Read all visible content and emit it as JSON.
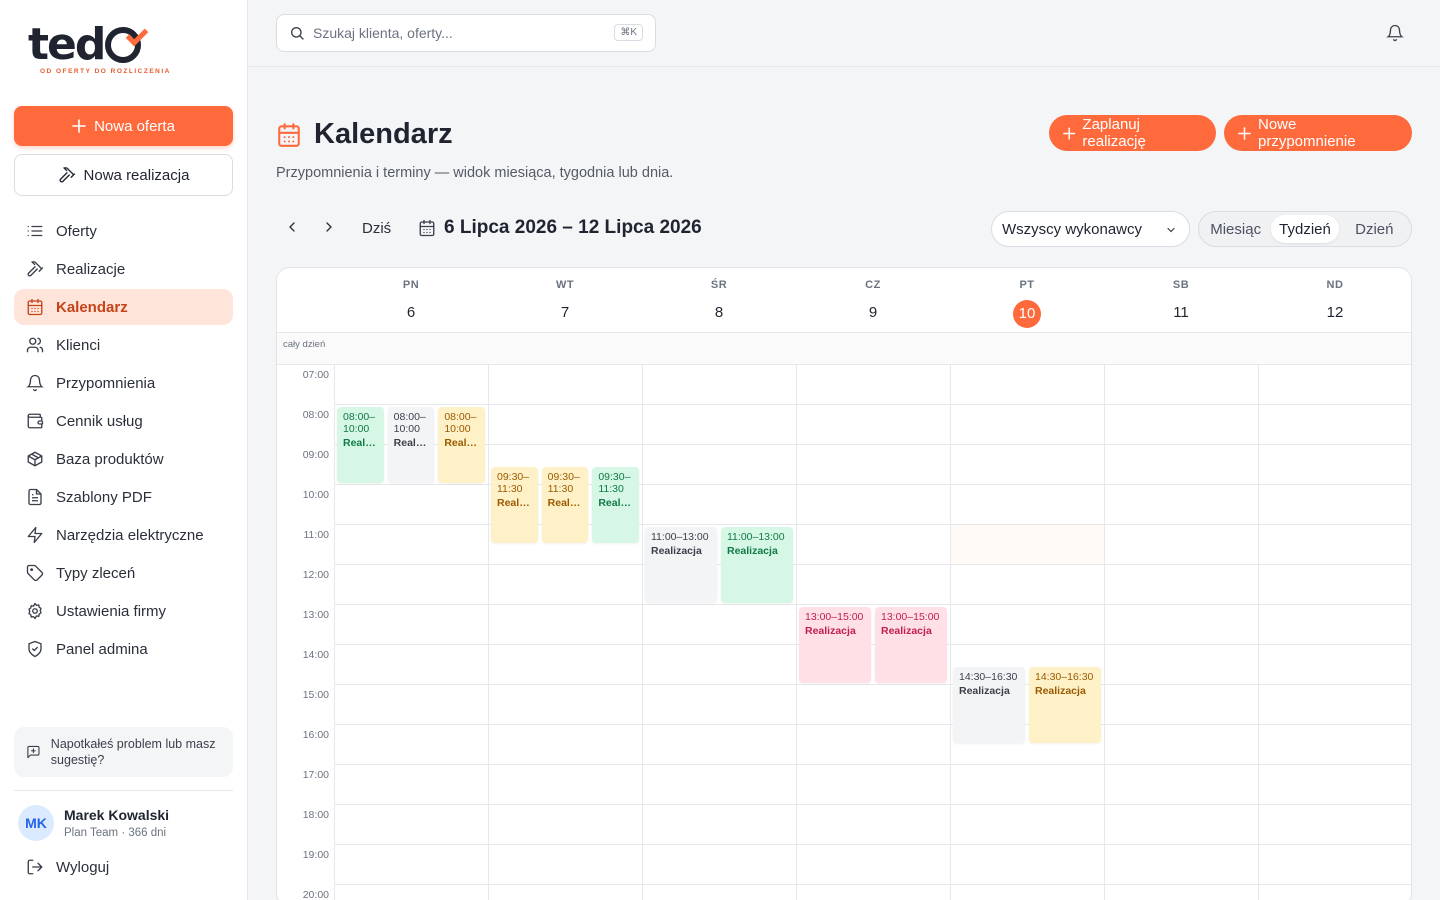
{
  "brand": {
    "name": "teodo",
    "tagline": "OD OFERTY DO ROZLICZENIA"
  },
  "sidebar": {
    "new_offer": "Nowa oferta",
    "new_realization": "Nowa realizacja",
    "items": [
      {
        "label": "Oferty",
        "icon": "list-icon"
      },
      {
        "label": "Realizacje",
        "icon": "hammer-icon"
      },
      {
        "label": "Kalendarz",
        "icon": "calendar-icon",
        "active": true
      },
      {
        "label": "Klienci",
        "icon": "users-icon"
      },
      {
        "label": "Przypomnienia",
        "icon": "bell-icon"
      },
      {
        "label": "Cennik usług",
        "icon": "wallet-icon"
      },
      {
        "label": "Baza produktów",
        "icon": "package-icon"
      },
      {
        "label": "Szablony PDF",
        "icon": "file-icon"
      },
      {
        "label": "Narzędzia elektryczne",
        "icon": "zap-icon"
      },
      {
        "label": "Typy zleceń",
        "icon": "tag-icon"
      },
      {
        "label": "Ustawienia firmy",
        "icon": "gear-icon"
      },
      {
        "label": "Panel admina",
        "icon": "shield-icon"
      }
    ],
    "feedback": "Napotkałeś problem lub masz sugestię?",
    "user": {
      "initials": "MK",
      "name": "Marek Kowalski",
      "plan": "Plan Team · 366 dni"
    },
    "logout": "Wyloguj"
  },
  "topbar": {
    "search_placeholder": "Szukaj klienta, oferty...",
    "shortcut": "⌘K"
  },
  "page": {
    "title": "Kalendarz",
    "subtitle": "Przypomnienia i terminy — widok miesiąca, tygodnia lub dnia.",
    "btn_schedule": "Zaplanuj realizację",
    "btn_reminder": "Nowe przypomnienie"
  },
  "toolbar": {
    "today": "Dziś",
    "range": "6 Lipca 2026 – 12 Lipca 2026",
    "assignee": "Wszyscy wykonawcy",
    "views": [
      "Miesiąc",
      "Tydzień",
      "Dzień"
    ],
    "active_view": "Tydzień"
  },
  "calendar": {
    "allday_label": "cały dzień",
    "days": [
      {
        "name": "PN",
        "num": "6"
      },
      {
        "name": "WT",
        "num": "7"
      },
      {
        "name": "ŚR",
        "num": "8"
      },
      {
        "name": "CZ",
        "num": "9"
      },
      {
        "name": "PT",
        "num": "10",
        "today": true
      },
      {
        "name": "SB",
        "num": "11"
      },
      {
        "name": "ND",
        "num": "12"
      }
    ],
    "hours": [
      "07:00",
      "08:00",
      "09:00",
      "10:00",
      "11:00",
      "12:00",
      "13:00",
      "14:00",
      "15:00",
      "16:00",
      "17:00",
      "18:00",
      "19:00",
      "20:00"
    ],
    "events": [
      {
        "day": 0,
        "col": 0,
        "cols": 3,
        "start": 8,
        "end": 10,
        "time": "08:00–10:00",
        "title": "Realizacja",
        "color": "green"
      },
      {
        "day": 0,
        "col": 1,
        "cols": 3,
        "start": 8,
        "end": 10,
        "time": "08:00–10:00",
        "title": "Realizacja",
        "color": "gray"
      },
      {
        "day": 0,
        "col": 2,
        "cols": 3,
        "start": 8,
        "end": 10,
        "time": "08:00–10:00",
        "title": "Realizacja",
        "color": "yellow"
      },
      {
        "day": 1,
        "col": 0,
        "cols": 3,
        "start": 9.5,
        "end": 11.5,
        "time": "09:30–11:30",
        "title": "Realizacja",
        "color": "yellow"
      },
      {
        "day": 1,
        "col": 1,
        "cols": 3,
        "start": 9.5,
        "end": 11.5,
        "time": "09:30–11:30",
        "title": "Realizacja",
        "color": "yellow"
      },
      {
        "day": 1,
        "col": 2,
        "cols": 3,
        "start": 9.5,
        "end": 11.5,
        "time": "09:30–11:30",
        "title": "Realizacja",
        "color": "green"
      },
      {
        "day": 2,
        "col": 0,
        "cols": 2,
        "start": 11,
        "end": 13,
        "time": "11:00–13:00",
        "title": "Realizacja",
        "color": "gray"
      },
      {
        "day": 2,
        "col": 1,
        "cols": 2,
        "start": 11,
        "end": 13,
        "time": "11:00–13:00",
        "title": "Realizacja",
        "color": "green"
      },
      {
        "day": 3,
        "col": 0,
        "cols": 2,
        "start": 13,
        "end": 15,
        "time": "13:00–15:00",
        "title": "Realizacja",
        "color": "pink"
      },
      {
        "day": 3,
        "col": 1,
        "cols": 2,
        "start": 13,
        "end": 15,
        "time": "13:00–15:00",
        "title": "Realizacja",
        "color": "pink"
      },
      {
        "day": 4,
        "col": 0,
        "cols": 2,
        "start": 14.5,
        "end": 16.5,
        "time": "14:30–16:30",
        "title": "Realizacja",
        "color": "gray"
      },
      {
        "day": 4,
        "col": 1,
        "cols": 2,
        "start": 14.5,
        "end": 16.5,
        "time": "14:30–16:30",
        "title": "Realizacja",
        "color": "yellow"
      }
    ]
  },
  "colors": {
    "accent": "#ff6a3d",
    "active_bg": "#ffe4d9",
    "active_text": "#c4441a"
  }
}
